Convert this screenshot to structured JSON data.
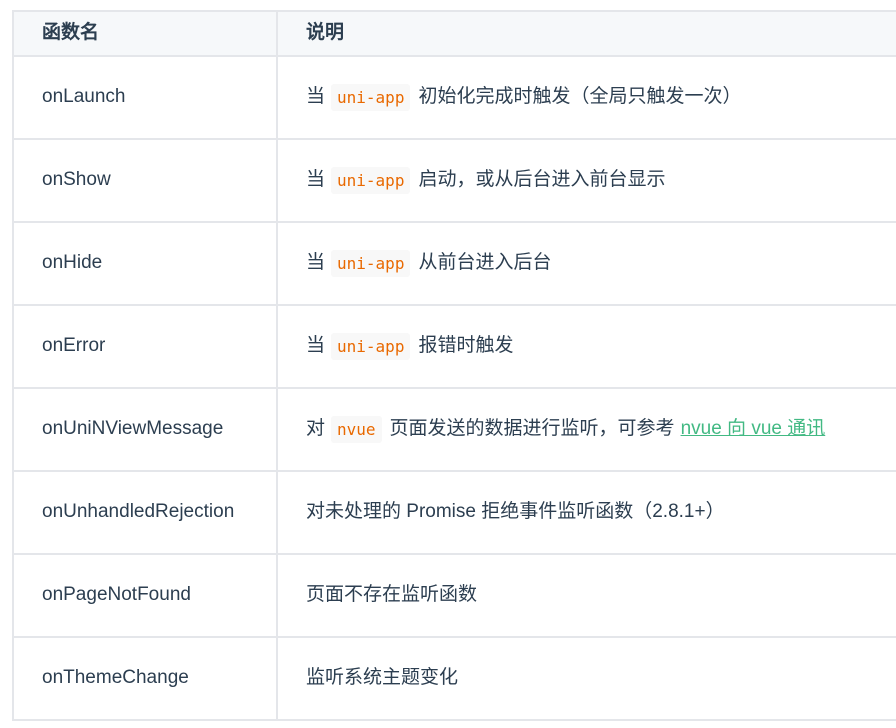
{
  "table": {
    "headers": {
      "name": "函数名",
      "desc": "说明"
    },
    "rows": [
      {
        "name": "onLaunch",
        "desc_pre": "当",
        "code": "uni-app",
        "desc_post": "初始化完成时触发（全局只触发一次）",
        "link": ""
      },
      {
        "name": "onShow",
        "desc_pre": "当",
        "code": "uni-app",
        "desc_post": "启动，或从后台进入前台显示",
        "link": ""
      },
      {
        "name": "onHide",
        "desc_pre": "当",
        "code": "uni-app",
        "desc_post": "从前台进入后台",
        "link": ""
      },
      {
        "name": "onError",
        "desc_pre": "当",
        "code": "uni-app",
        "desc_post": "报错时触发",
        "link": ""
      },
      {
        "name": "onUniNViewMessage",
        "desc_pre": "对",
        "code": "nvue",
        "desc_post": "页面发送的数据进行监听，可参考",
        "link": "nvue 向 vue 通讯"
      },
      {
        "name": "onUnhandledRejection",
        "desc_pre": "对未处理的 Promise 拒绝事件监听函数（2.8.1+）",
        "code": "",
        "desc_post": "",
        "link": ""
      },
      {
        "name": "onPageNotFound",
        "desc_pre": "页面不存在监听函数",
        "code": "",
        "desc_post": "",
        "link": ""
      },
      {
        "name": "onThemeChange",
        "desc_pre": "监听系统主题变化",
        "code": "",
        "desc_post": "",
        "link": ""
      }
    ]
  },
  "colors": {
    "text": "#2c3e50",
    "code": "#e96900",
    "link": "#42b983",
    "border": "#e4e6ea",
    "header_bg": "#f6f8fa"
  }
}
